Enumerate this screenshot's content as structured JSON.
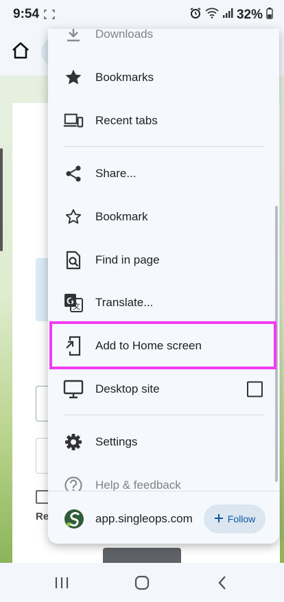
{
  "status_bar": {
    "time": "9:54",
    "battery": "32%"
  },
  "menu": {
    "items": [
      {
        "label": "Downloads",
        "icon": "download-icon"
      },
      {
        "label": "Bookmarks",
        "icon": "star-filled-icon"
      },
      {
        "label": "Recent tabs",
        "icon": "devices-icon"
      },
      {
        "label": "Share...",
        "icon": "share-icon"
      },
      {
        "label": "Bookmark",
        "icon": "star-outline-icon"
      },
      {
        "label": "Find in page",
        "icon": "find-in-page-icon"
      },
      {
        "label": "Translate...",
        "icon": "translate-icon"
      },
      {
        "label": "Add to Home screen",
        "icon": "add-to-home-icon"
      },
      {
        "label": "Desktop site",
        "icon": "desktop-icon",
        "checked": false
      },
      {
        "label": "Settings",
        "icon": "gear-icon"
      },
      {
        "label": "Help & feedback",
        "icon": "help-icon"
      }
    ],
    "footer": {
      "site": "app.singleops.com",
      "follow_label": "Follow"
    }
  },
  "page_background": {
    "text_fragment": "Re"
  },
  "colors": {
    "highlight": "#f03cf0",
    "follow_text": "#0b57a0",
    "menu_bg": "#f5f8fc"
  }
}
